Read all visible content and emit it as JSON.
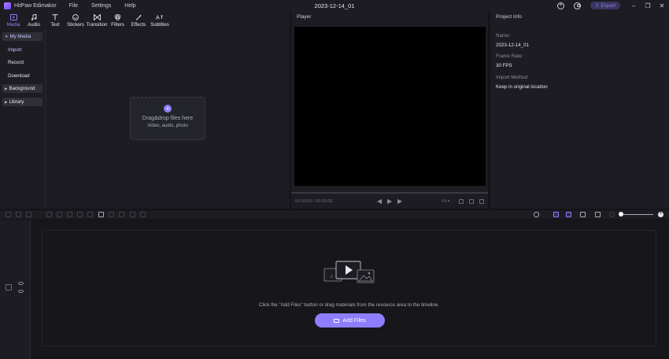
{
  "titlebar": {
    "app_name": "HitPaw Edimakor",
    "menu": [
      "File",
      "Settings",
      "Help"
    ],
    "doc_title": "2023-12-14_01",
    "export_label": "Export"
  },
  "toolbar": {
    "tabs": [
      {
        "label": "Media",
        "icon": "media-icon",
        "active": true
      },
      {
        "label": "Audio",
        "icon": "music-note-icon",
        "active": false
      },
      {
        "label": "Text",
        "icon": "text-icon",
        "active": false
      },
      {
        "label": "Stickers",
        "icon": "sticker-icon",
        "active": false
      },
      {
        "label": "Transition",
        "icon": "transition-icon",
        "active": false
      },
      {
        "label": "Filters",
        "icon": "filters-icon",
        "active": false
      },
      {
        "label": "Effects",
        "icon": "effects-icon",
        "active": false
      },
      {
        "label": "Subtitles",
        "icon": "subtitles-icon",
        "active": false
      }
    ]
  },
  "sidebar": {
    "my_media": "My Media",
    "import": "Import",
    "record": "Record",
    "download": "Download",
    "background": "Background",
    "library": "Library"
  },
  "dropzone": {
    "title": "Drag&drop files here",
    "subtitle": "Video, audio, photo"
  },
  "player": {
    "title": "Player",
    "time": "00:00:00 / 00:00:00",
    "zoom": "Fit"
  },
  "project_info": {
    "title": "Project Info",
    "name_label": "Name:",
    "name_value": "2023-12-14_01",
    "frame_rate_label": "Frame Rate:",
    "frame_rate_value": "30 FPS",
    "import_method_label": "Import Method:",
    "import_method_value": "Keep in original location"
  },
  "timeline": {
    "message": "Click the \"Add Files\" button or drag materials from the resource area to the timeline.",
    "add_files_label": "Add Files"
  },
  "colors": {
    "accent": "#8f7dff",
    "background": "#141418",
    "panel": "#1c1c22"
  }
}
